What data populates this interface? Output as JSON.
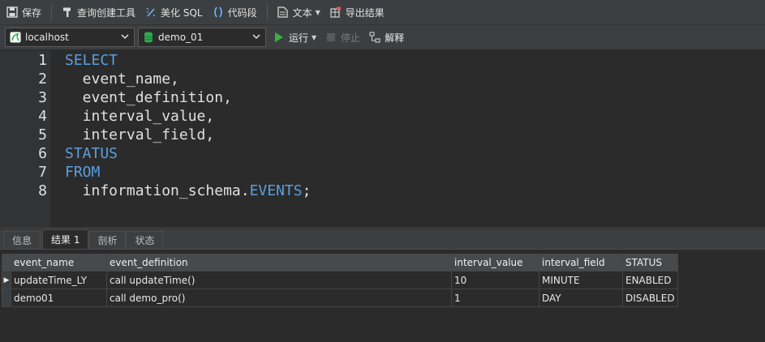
{
  "toolbar": {
    "save": "保存",
    "query_builder": "查询创建工具",
    "beautify_sql": "美化 SQL",
    "code_snippet": "代码段",
    "text": "文本",
    "export_results": "导出结果"
  },
  "toolbar2": {
    "connection": "localhost",
    "database": "demo_01",
    "run": "运行",
    "stop": "停止",
    "explain": "解释"
  },
  "editor": {
    "line_numbers": [
      "1",
      "2",
      "3",
      "4",
      "5",
      "6",
      "7",
      "8"
    ],
    "lines": [
      {
        "kw": "SELECT",
        "text": ""
      },
      {
        "kw": "",
        "text": "  event_name,"
      },
      {
        "kw": "",
        "text": "  event_definition,"
      },
      {
        "kw": "",
        "text": "  interval_value,"
      },
      {
        "kw": "",
        "text": "  interval_field,"
      },
      {
        "kw": "STATUS",
        "text": ""
      },
      {
        "kw": "FROM",
        "text": ""
      },
      {
        "text_before": "  information_schema.",
        "kw": "EVENTS",
        "text_after": ";"
      }
    ]
  },
  "tabs": [
    "信息",
    "结果 1",
    "剖析",
    "状态"
  ],
  "results": {
    "columns": [
      "event_name",
      "event_definition",
      "interval_value",
      "interval_field",
      "STATUS"
    ],
    "rows": [
      [
        "updateTime_LY",
        "call updateTime()",
        "10",
        "MINUTE",
        "ENABLED"
      ],
      [
        "demo01",
        "call demo_pro()",
        "1",
        "DAY",
        "DISABLED"
      ]
    ]
  },
  "colors": {
    "keyword": "#5a9ee0",
    "run_icon": "#3cb043",
    "db_icon": "#2fa84f"
  }
}
